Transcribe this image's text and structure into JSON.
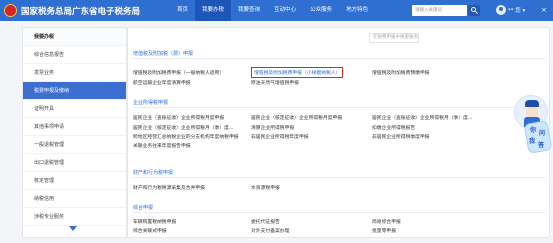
{
  "header": {
    "brand": "国家税务总局广东省电子税务局",
    "nav": [
      {
        "label": "首页",
        "active": false
      },
      {
        "label": "我要办税",
        "active": true
      },
      {
        "label": "我要查询",
        "active": false
      },
      {
        "label": "互动中心",
        "active": false
      },
      {
        "label": "公众服务",
        "active": false
      },
      {
        "label": "地方特色",
        "active": false
      }
    ],
    "search_placeholder": "请输入关键词",
    "user": "** 您 ▾",
    "close": "×"
  },
  "sidebar": {
    "items": [
      {
        "label": "我要办税",
        "head": true,
        "active": false
      },
      {
        "label": "综合信息报告",
        "head": false,
        "active": false
      },
      {
        "label": "发票业务",
        "head": false,
        "active": false
      },
      {
        "label": "税费申报及缴纳",
        "head": false,
        "active": true
      },
      {
        "label": "证明开具",
        "head": false,
        "active": false
      },
      {
        "label": "其他事项申请",
        "head": false,
        "active": false
      },
      {
        "label": "一般退税管理",
        "head": false,
        "active": false
      },
      {
        "label": "出口退税管理",
        "head": false,
        "active": false
      },
      {
        "label": "核定管理",
        "head": false,
        "active": false
      },
      {
        "label": "纳税信用",
        "head": false,
        "active": false
      },
      {
        "label": "涉税专业服务",
        "head": false,
        "active": false
      }
    ]
  },
  "main": {
    "filter_placeholder": "在税费申报中搜索服务名称",
    "sections": [
      {
        "title": "增值税及附加税（费）申报",
        "links": [
          "增值税及附加税费申报（一般纳税人适用）",
          "增值税及附加税费申报（小规模纳税人）",
          "增值税及附加税费预缴申报",
          "航空运输企业年度清算申报",
          "原油天然气增值税申报"
        ]
      },
      {
        "title": "企业所得税申报",
        "links": [
          "居民企业（查账征收）企业所得税月度申报",
          "居民企业（核定征收）企业所得税月度申报",
          "居民企业（查账征收）企业所得税月（季）度...",
          "居民企业（核定征收）企业所得税月（季）度...",
          "清算企业所得税申报",
          "扣缴企业所得税报告",
          "跨地区经营汇总纳税企业的分支机构年度纳税申报",
          "非居民企业所得税年度申报",
          "非居民企业所得税季度申报",
          "关联业务往来年度报告申报"
        ]
      },
      {
        "title": "财产和行为税申报",
        "links": [
          "财产和行为税税源采集及合并申报",
          "水资源税申报"
        ]
      },
      {
        "title": "综合申报",
        "links": [
          "车辆购置税纳税申报",
          "委托代征报告",
          "简易综合申报",
          "综合关联式申报",
          "对外支付备案办理",
          "批量零申报"
        ]
      }
    ]
  },
  "helper": {
    "line1": "你",
    "line2": "问",
    "line3": "我",
    "line4": "答"
  }
}
